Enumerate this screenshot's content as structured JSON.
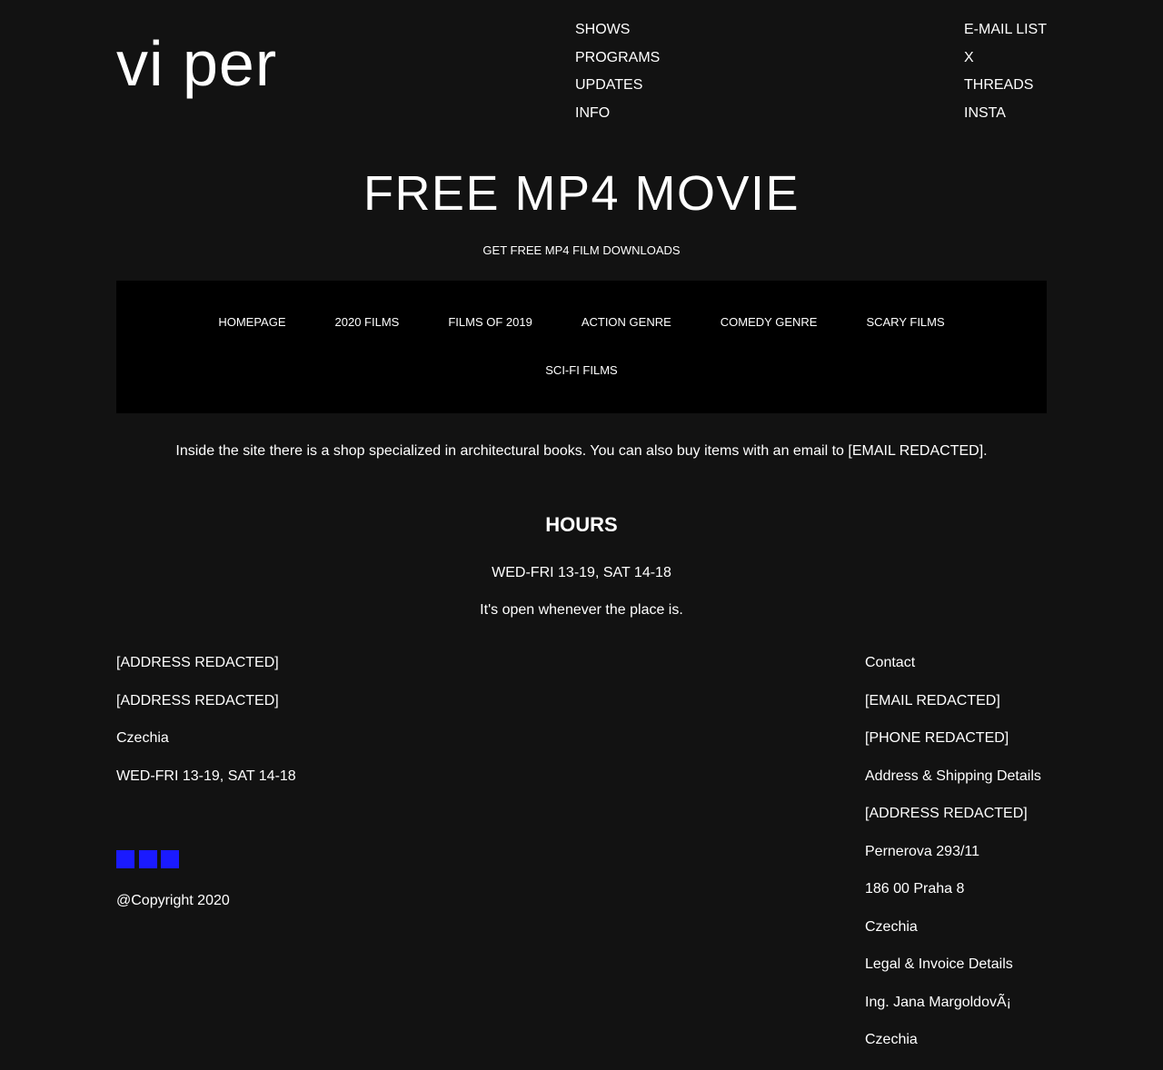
{
  "header": {
    "logo": "vi per",
    "nav_left": [
      "SHOWS",
      "PROGRAMS",
      "UPDATES",
      "INFO"
    ],
    "nav_right": [
      "E-MAIL LIST",
      "X",
      "THREADS",
      "INSTA"
    ]
  },
  "hero": {
    "title": "FREE MP4 MOVIE",
    "tagline": "GET FREE MP4 FILM DOWNLOADS"
  },
  "menu": {
    "items": [
      "HOMEPAGE",
      "2020 FILMS",
      "FILMS OF 2019",
      "ACTION GENRE",
      "COMEDY GENRE",
      "SCARY FILMS",
      "SCI-FI FILMS"
    ]
  },
  "intro": {
    "text": "Inside the site there is a shop specialized in architectural books. You can also buy items with an email to [EMAIL REDACTED]."
  },
  "hours": {
    "title": "HOURS",
    "time": "WED-FRI 13-19, SAT 14-18",
    "note": "It's open whenever the place is."
  },
  "footer": {
    "left": [
      "[ADDRESS REDACTED]",
      "[ADDRESS REDACTED]",
      "Czechia",
      "WED-FRI 13-19, SAT 14-18"
    ],
    "right": [
      "Contact",
      "[EMAIL REDACTED]",
      "[PHONE REDACTED]",
      "Address & Shipping Details",
      "[ADDRESS REDACTED]",
      "Pernerova 293/11",
      "186 00 Praha 8",
      "Czechia",
      "Legal & Invoice Details",
      "Ing. Jana MargoldovÃ¡",
      "Czechia"
    ],
    "social_icons": [
      "social-icon-1",
      "social-icon-2",
      "social-icon-3"
    ],
    "social_color": "#1a1aff",
    "copyright": "@Copyright 2020"
  },
  "colors": {
    "background": "#121212",
    "menu_background": "#000000",
    "text": "#ffffff"
  }
}
